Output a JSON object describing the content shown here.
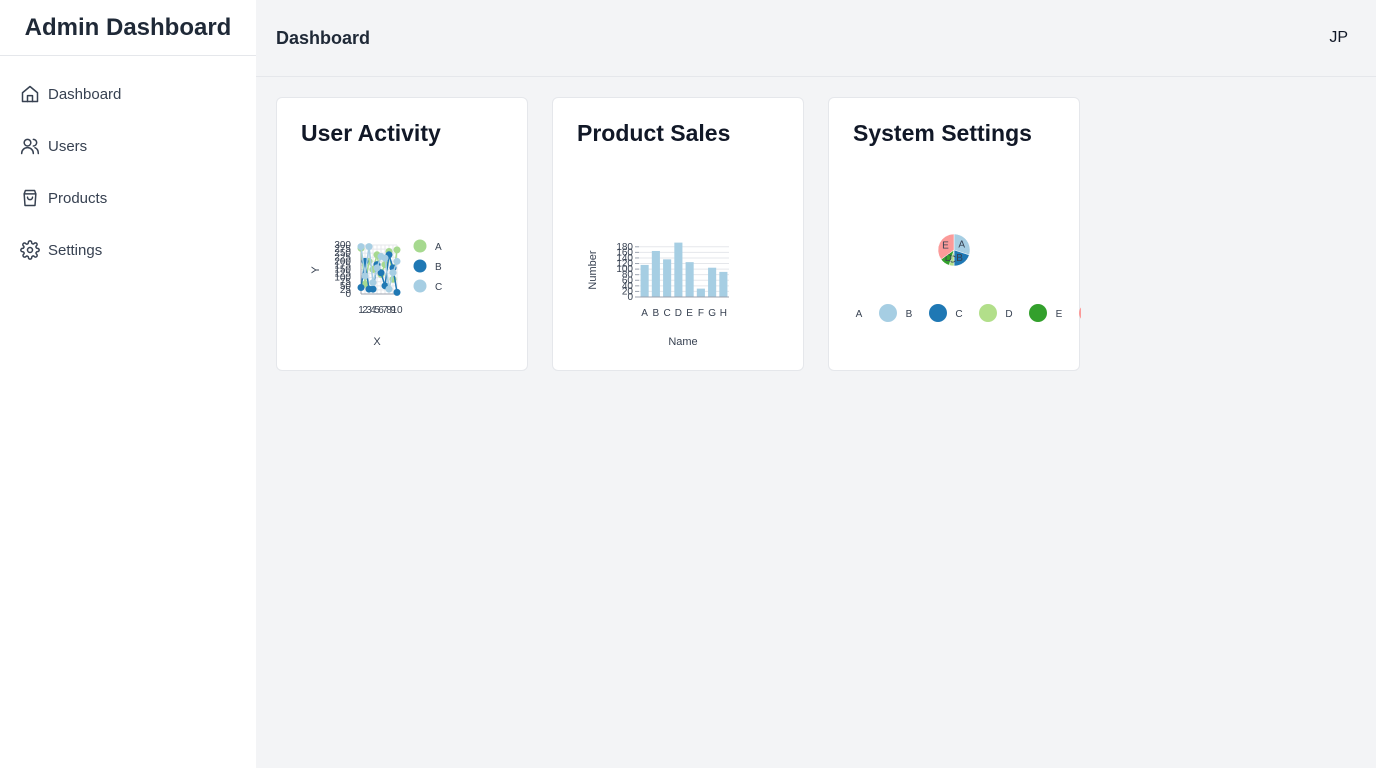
{
  "sidebar": {
    "brand": "Admin Dashboard",
    "items": [
      {
        "label": "Dashboard",
        "icon": "home-icon"
      },
      {
        "label": "Users",
        "icon": "users-icon"
      },
      {
        "label": "Products",
        "icon": "shopping-bag-icon"
      },
      {
        "label": "Settings",
        "icon": "gear-icon"
      }
    ]
  },
  "header": {
    "title": "Dashboard",
    "avatar": "JP"
  },
  "cards": [
    {
      "title": "User Activity"
    },
    {
      "title": "Product Sales"
    },
    {
      "title": "System Settings"
    }
  ],
  "colors": {
    "accent_light_green": "#a6d98f",
    "accent_dark_blue": "#1f6fae",
    "accent_light_blue": "#a6cee3",
    "accent_green": "#33a02c",
    "accent_pink": "#fb9a99"
  },
  "chart_data": [
    {
      "type": "scatter",
      "xlabel": "X",
      "ylabel": "Y",
      "x_ticks": [
        "1",
        "2",
        "3",
        "4",
        "5",
        "6",
        "7",
        "8",
        "9",
        "10"
      ],
      "y_ticks": [
        "0",
        "25",
        "50",
        "75",
        "100",
        "125",
        "150",
        "175",
        "200",
        "225",
        "250",
        "275",
        "300"
      ],
      "ylim": [
        0,
        300
      ],
      "xlim": [
        1,
        10
      ],
      "legend": "right",
      "series": [
        {
          "name": "A",
          "color": "#a6d98f",
          "x": [
            1,
            2,
            3,
            4,
            5,
            6,
            7,
            8,
            9,
            10
          ],
          "y": [
            280,
            60,
            200,
            150,
            240,
            120,
            180,
            260,
            90,
            270
          ]
        },
        {
          "name": "B",
          "color": "#1f78b4",
          "x": [
            1,
            2,
            3,
            4,
            5,
            6,
            7,
            8,
            9,
            10
          ],
          "y": [
            40,
            200,
            30,
            30,
            180,
            130,
            50,
            240,
            160,
            10
          ]
        },
        {
          "name": "C",
          "color": "#a6cee3",
          "x": [
            1,
            2,
            3,
            4,
            5,
            6,
            7,
            8,
            9,
            10
          ],
          "y": [
            290,
            110,
            290,
            70,
            160,
            230,
            220,
            30,
            130,
            200
          ]
        }
      ]
    },
    {
      "type": "bar",
      "xlabel": "Name",
      "ylabel": "Number",
      "categories": [
        "A",
        "B",
        "C",
        "D",
        "E",
        "F",
        "G",
        "H"
      ],
      "values": [
        115,
        165,
        135,
        195,
        125,
        30,
        105,
        90
      ],
      "y_ticks": [
        "0",
        "20",
        "40",
        "60",
        "80",
        "100",
        "120",
        "140",
        "160",
        "180"
      ],
      "ylim": [
        0,
        190
      ],
      "color": "#a6cee3"
    },
    {
      "type": "pie",
      "labels": [
        "A",
        "B",
        "C",
        "D",
        "E"
      ],
      "values": [
        30,
        20,
        5,
        10,
        35
      ],
      "colors": [
        "#a6cee3",
        "#1f78b4",
        "#b2df8a",
        "#33a02c",
        "#fb9a99"
      ],
      "legend": "bottom"
    }
  ]
}
